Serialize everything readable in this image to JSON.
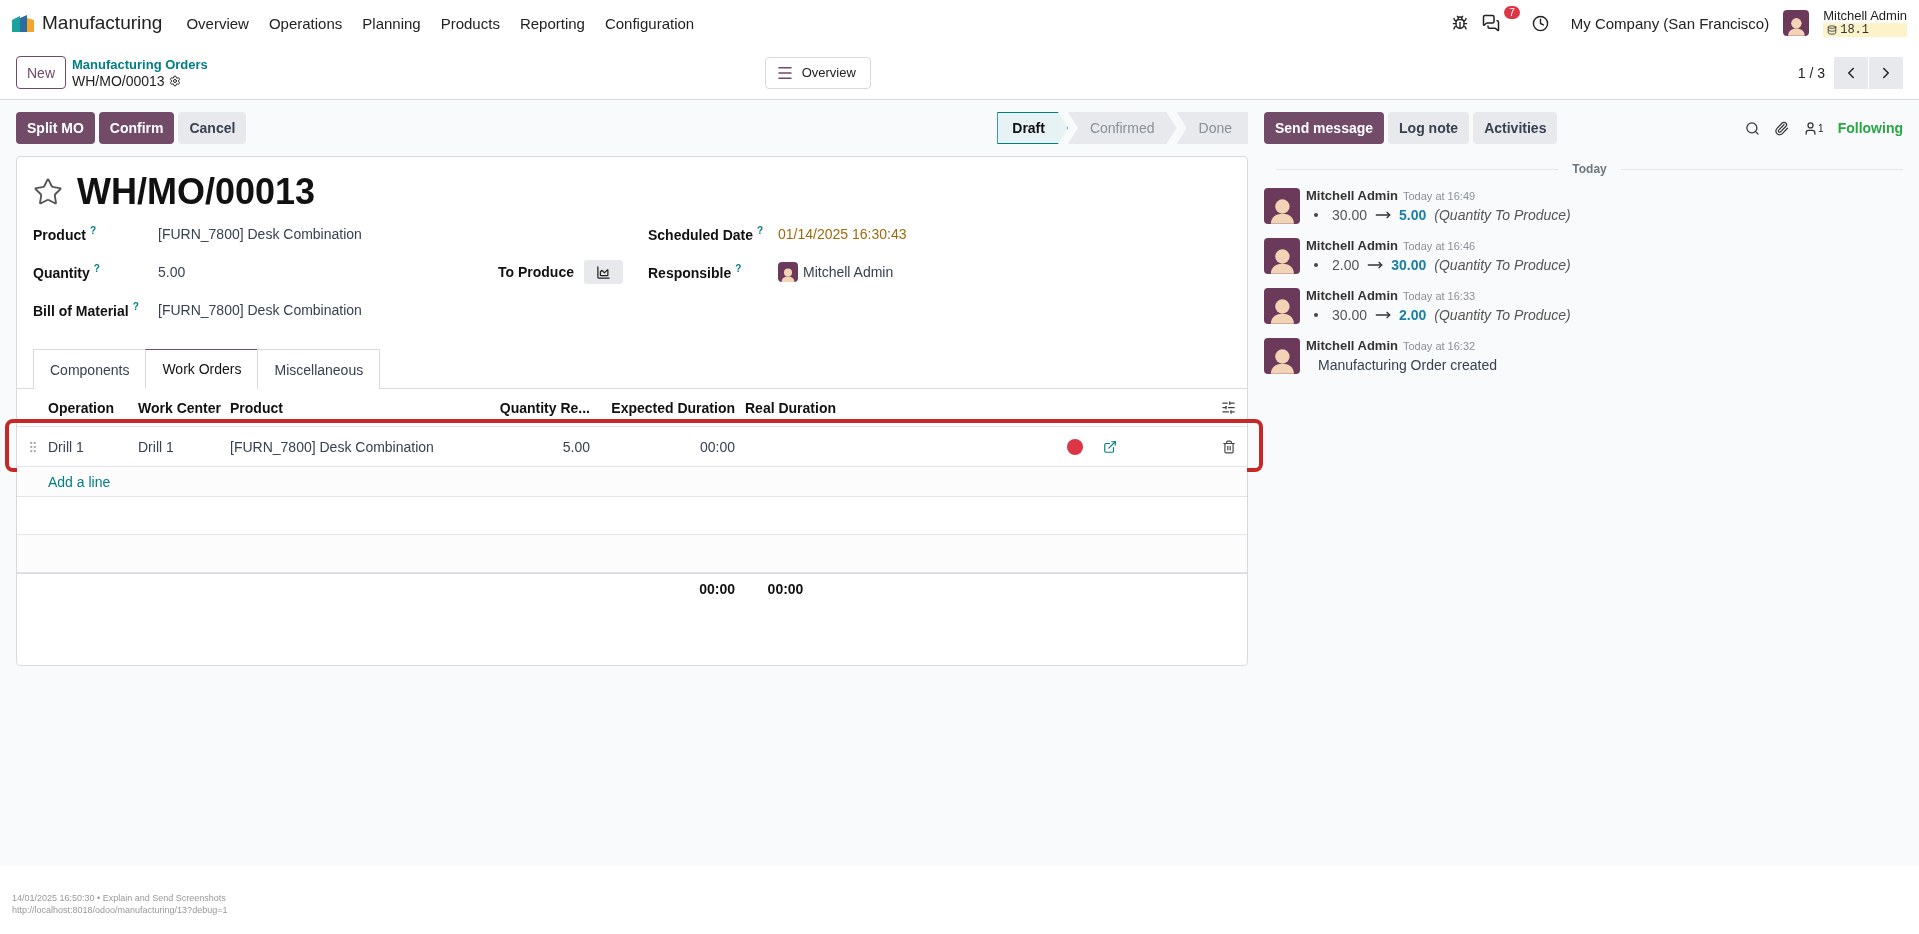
{
  "navbar": {
    "app": "Manufacturing",
    "menu": [
      "Overview",
      "Operations",
      "Planning",
      "Products",
      "Reporting",
      "Configuration"
    ],
    "notification_count": "7",
    "company": "My Company (San Francisco)",
    "user": "Mitchell Admin",
    "version": "18.1"
  },
  "control_panel": {
    "new_button": "New",
    "breadcrumb": "Manufacturing Orders",
    "record": "WH/MO/00013",
    "overview_button": "Overview",
    "pager": "1 / 3"
  },
  "actions": [
    {
      "label": "Split MO",
      "kind": "primary"
    },
    {
      "label": "Confirm",
      "kind": "primary"
    },
    {
      "label": "Cancel",
      "kind": "secondary"
    }
  ],
  "statusbar": [
    {
      "label": "Draft",
      "selected": true
    },
    {
      "label": "Confirmed",
      "selected": false
    },
    {
      "label": "Done",
      "selected": false
    }
  ],
  "form": {
    "title": "WH/MO/00013",
    "starred": false,
    "left_fields": [
      {
        "label": "Product",
        "help": "?",
        "value": "[FURN_7800] Desk Combination"
      },
      {
        "label": "Quantity",
        "help": "?",
        "value": "5.00"
      },
      {
        "label": "Bill of Material",
        "help": "?",
        "value": "[FURN_7800] Desk Combination"
      }
    ],
    "to_produce": "To Produce",
    "right_fields": [
      {
        "label": "Scheduled Date",
        "help": "?",
        "value": "01/14/2025 16:30:43",
        "kind": "date"
      },
      {
        "label": "Responsible",
        "help": "?",
        "value": "Mitchell Admin",
        "kind": "user"
      }
    ],
    "tabs": [
      {
        "label": "Components",
        "selected": false
      },
      {
        "label": "Work Orders",
        "selected": true
      },
      {
        "label": "Miscellaneous",
        "selected": false
      }
    ],
    "table": {
      "columns": [
        "Operation",
        "Work Center",
        "Product",
        "Quantity Re...",
        "Expected Duration",
        "Real Duration"
      ],
      "rows": [
        {
          "cells": [
            "Drill 1",
            "Drill 1",
            "[FURN_7800] Desk Combination",
            "5.00",
            "00:00"
          ],
          "color": "#dc3545",
          "highlighted": true
        }
      ],
      "add_line": "Add a line",
      "totals": [
        "00:00",
        "00:00"
      ]
    }
  },
  "chatter": {
    "buttons": [
      {
        "label": "Send message",
        "kind": "primary"
      },
      {
        "label": "Log note",
        "kind": "secondary"
      },
      {
        "label": "Activities",
        "kind": "secondary"
      }
    ],
    "follower_count": "1",
    "following": "Following",
    "date_separator": "Today",
    "messages": [
      {
        "author": "Mitchell Admin",
        "time": "Today at 16:49",
        "kind": "tracking",
        "old": "30.00",
        "new": "5.00",
        "field": "(Quantity To Produce)"
      },
      {
        "author": "Mitchell Admin",
        "time": "Today at 16:46",
        "kind": "tracking",
        "old": "2.00",
        "new": "30.00",
        "field": "(Quantity To Produce)"
      },
      {
        "author": "Mitchell Admin",
        "time": "Today at 16:33",
        "kind": "tracking",
        "old": "30.00",
        "new": "2.00",
        "field": "(Quantity To Produce)"
      },
      {
        "author": "Mitchell Admin",
        "time": "Today at 16:32",
        "kind": "text",
        "body": "Manufacturing Order created"
      }
    ]
  },
  "footer": {
    "caption": "14/01/2025 16:50:30 • Explain and Send Screenshots",
    "url": "http://localhost:8018/odoo/manufacturing/13?debug=1"
  }
}
